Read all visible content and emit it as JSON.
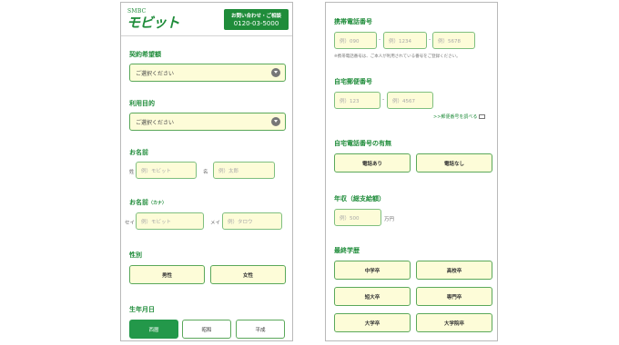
{
  "left": {
    "logo": {
      "smbc": "SMBC",
      "name": "モビット"
    },
    "contact": {
      "label": "お問い合わせ・ご相談",
      "phone": "0120-03-5000"
    },
    "desired_amount": {
      "label": "契約希望額",
      "value": "ご選択ください"
    },
    "purpose": {
      "label": "利用目的",
      "value": "ご選択ください"
    },
    "name": {
      "label": "お名前",
      "last_label": "姓",
      "last_placeholder": "例）モビット",
      "first_label": "名",
      "first_placeholder": "例）太郎"
    },
    "name_kana": {
      "label": "お名前",
      "label_suffix": "（カナ）",
      "last_label": "セイ",
      "last_placeholder": "例）モビット",
      "first_label": "メイ",
      "first_placeholder": "例）タロウ"
    },
    "gender": {
      "label": "性別",
      "options": [
        "男性",
        "女性"
      ]
    },
    "birthdate": {
      "label": "生年月日",
      "eras": [
        "西暦",
        "昭和",
        "平成"
      ],
      "selected": "西暦"
    }
  },
  "right": {
    "mobile": {
      "label": "携帯電話番号",
      "placeholders": [
        "例）090",
        "例）1234",
        "例）5678"
      ],
      "note": "※携帯電話番号は、ご本人が利用されている番号をご登録ください。"
    },
    "postal": {
      "label": "自宅郵便番号",
      "placeholders": [
        "例）123",
        "例）4567"
      ],
      "lookup_link": ">>郵便番号を調べる"
    },
    "home_phone": {
      "label": "自宅電話番号の有無",
      "options": [
        "電話あり",
        "電話なし"
      ]
    },
    "income": {
      "label": "年収（総支給額）",
      "placeholder": "例）500",
      "unit": "万円"
    },
    "education": {
      "label": "最終学歴",
      "options": [
        "中学卒",
        "高校卒",
        "短大卒",
        "専門卒",
        "大学卒",
        "大学院卒"
      ]
    }
  },
  "colors": {
    "brand_green": "#1f8c3a",
    "input_fill": "#fdfcd8",
    "border_green": "#5aa85a"
  }
}
